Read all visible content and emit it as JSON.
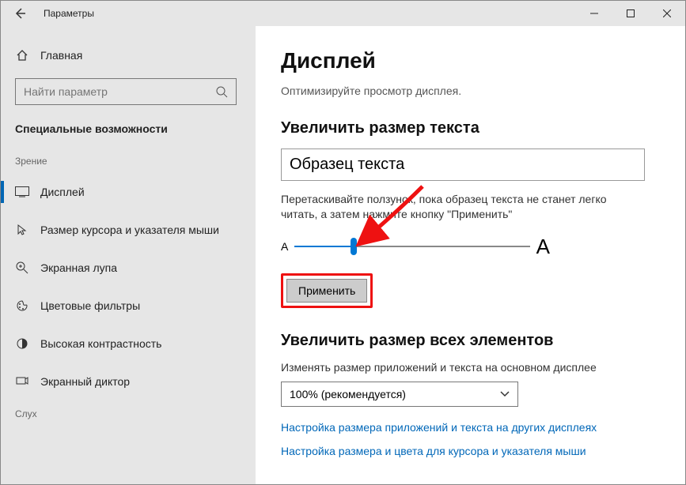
{
  "window": {
    "title": "Параметры"
  },
  "sidebar": {
    "home": "Главная",
    "search_placeholder": "Найти параметр",
    "category": "Специальные возможности",
    "groups": {
      "vision": "Зрение",
      "hearing": "Слух"
    },
    "items": [
      {
        "icon": "display",
        "label": "Дисплей"
      },
      {
        "icon": "cursor",
        "label": "Размер курсора и указателя мыши"
      },
      {
        "icon": "magnifier",
        "label": "Экранная лупа"
      },
      {
        "icon": "palette",
        "label": "Цветовые фильтры"
      },
      {
        "icon": "contrast",
        "label": "Высокая контрастность"
      },
      {
        "icon": "narrator",
        "label": "Экранный диктор"
      }
    ]
  },
  "main": {
    "heading": "Дисплей",
    "description": "Оптимизируйте просмотр дисплея.",
    "section_text_size": {
      "title": "Увеличить размер текста",
      "sample": "Образец текста",
      "instructions": "Перетаскивайте ползунок, пока образец текста не станет легко читать, а затем нажмите кнопку \"Применить\"",
      "small_a": "A",
      "big_a": "A",
      "apply": "Применить"
    },
    "section_scale": {
      "title": "Увеличить размер всех элементов",
      "desc": "Изменять размер приложений и текста на основном дисплее",
      "select_value": "100% (рекомендуется)",
      "link1": "Настройка размера приложений и текста на других дисплеях",
      "link2": "Настройка размера и цвета для курсора и указателя мыши"
    }
  }
}
